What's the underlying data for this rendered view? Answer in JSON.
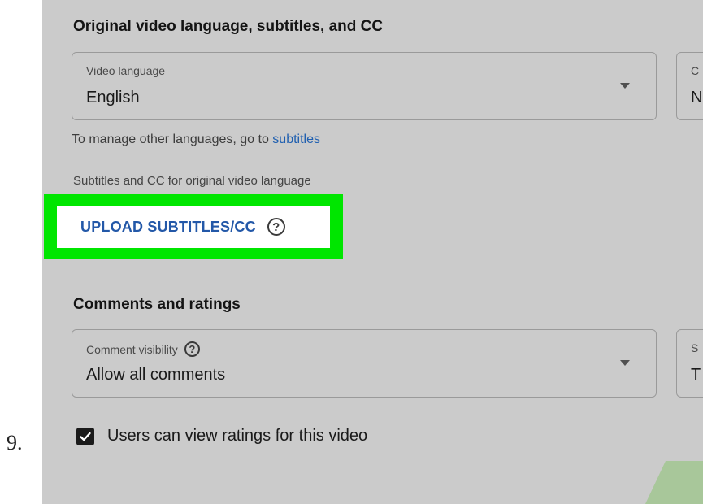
{
  "step": {
    "number": "9."
  },
  "language_section": {
    "title": "Original video language, subtitles, and CC",
    "video_language": {
      "label": "Video language",
      "value": "English"
    },
    "partial_dropdown": {
      "label": "C",
      "value": "N"
    },
    "manage_text": "To manage other languages, go to ",
    "manage_link": "subtitles",
    "subtitles_caption": "Subtitles and CC for original video language",
    "upload_button": "UPLOAD SUBTITLES/CC",
    "help_glyph": "?"
  },
  "comments_section": {
    "title": "Comments and ratings",
    "comment_visibility": {
      "label": "Comment visibility",
      "value": "Allow all comments"
    },
    "partial_dropdown": {
      "label": "S",
      "value": "T"
    },
    "help_glyph": "?",
    "ratings_checkbox": {
      "label": "Users can view ratings for this video",
      "checked": true
    }
  },
  "colors": {
    "highlight": "#00e600",
    "link": "#1f5fb0",
    "panel_background": "#cbcbcb"
  },
  "icons": [
    "help-icon",
    "dropdown-caret-icon",
    "checkmark-icon"
  ]
}
